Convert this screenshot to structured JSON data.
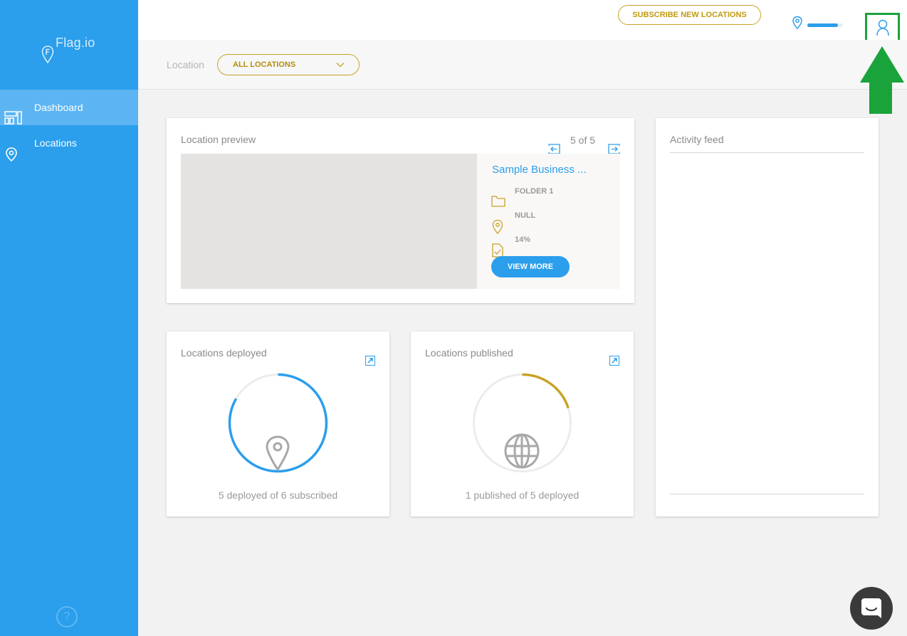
{
  "app": {
    "name": "Flag.io"
  },
  "sidebar": {
    "items": [
      {
        "label": "Dashboard",
        "icon": "dashboard-icon",
        "active": true
      },
      {
        "label": "Locations",
        "icon": "location-pin-icon",
        "active": false
      }
    ],
    "help_label": "?"
  },
  "topbar": {
    "subscribe_label": "SUBSCRIBE NEW LOCATIONS",
    "progress_fraction": 0.85,
    "user_icon": "user-icon"
  },
  "filter": {
    "label": "Location",
    "selected": "ALL LOCATIONS"
  },
  "preview": {
    "title": "Location preview",
    "pager": "5 of 5",
    "business_name": "Sample Business ...",
    "folder": "FOLDER 1",
    "address": "NULL",
    "completeness": "14%",
    "view_more_label": "VIEW MORE"
  },
  "activity": {
    "title": "Activity feed"
  },
  "deployed": {
    "title": "Locations deployed",
    "caption": "5 deployed of 6 subscribed",
    "value": 5,
    "total": 6,
    "color": "#2b9eec"
  },
  "published": {
    "title": "Locations published",
    "caption": "1 published of 5 deployed",
    "value": 1,
    "total": 5,
    "color": "#c9a227"
  },
  "colors": {
    "sidebar": "#2b9eec",
    "accent_gold": "#c9a227",
    "highlight_green": "#1aa33b"
  }
}
